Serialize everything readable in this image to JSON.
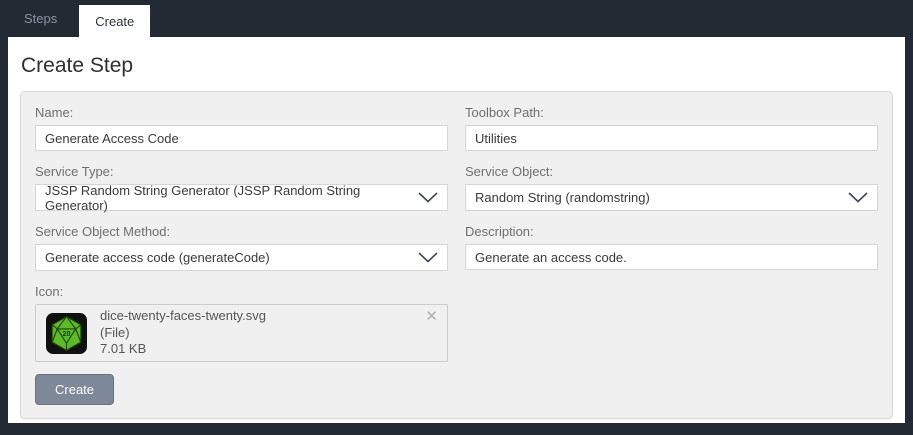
{
  "tabs": [
    {
      "label": "Steps",
      "active": false
    },
    {
      "label": "Create",
      "active": true
    }
  ],
  "page": {
    "title": "Create Step"
  },
  "form": {
    "name": {
      "label": "Name:",
      "value": "Generate Access Code"
    },
    "toolbox_path": {
      "label": "Toolbox Path:",
      "value": "Utilities"
    },
    "service_type": {
      "label": "Service Type:",
      "value": "JSSP Random String Generator (JSSP Random String Generator)"
    },
    "service_object": {
      "label": "Service Object:",
      "value": "Random String (randomstring)"
    },
    "service_object_method": {
      "label": "Service Object Method:",
      "value": "Generate access code (generateCode)"
    },
    "description": {
      "label": "Description:",
      "value": "Generate an access code."
    },
    "icon": {
      "label": "Icon:",
      "file_name": "dice-twenty-faces-twenty.svg",
      "file_kind": "(File)",
      "file_size": "7.01 KB",
      "remove_glyph": "✕",
      "thumbnail": "d20-dice-icon"
    },
    "create_button_label": "Create"
  },
  "colors": {
    "frame_dark": "#242a33",
    "panel_bg": "#f0f0f1",
    "accent_button": "#7d8899",
    "dice_green": "#5cbc24"
  }
}
